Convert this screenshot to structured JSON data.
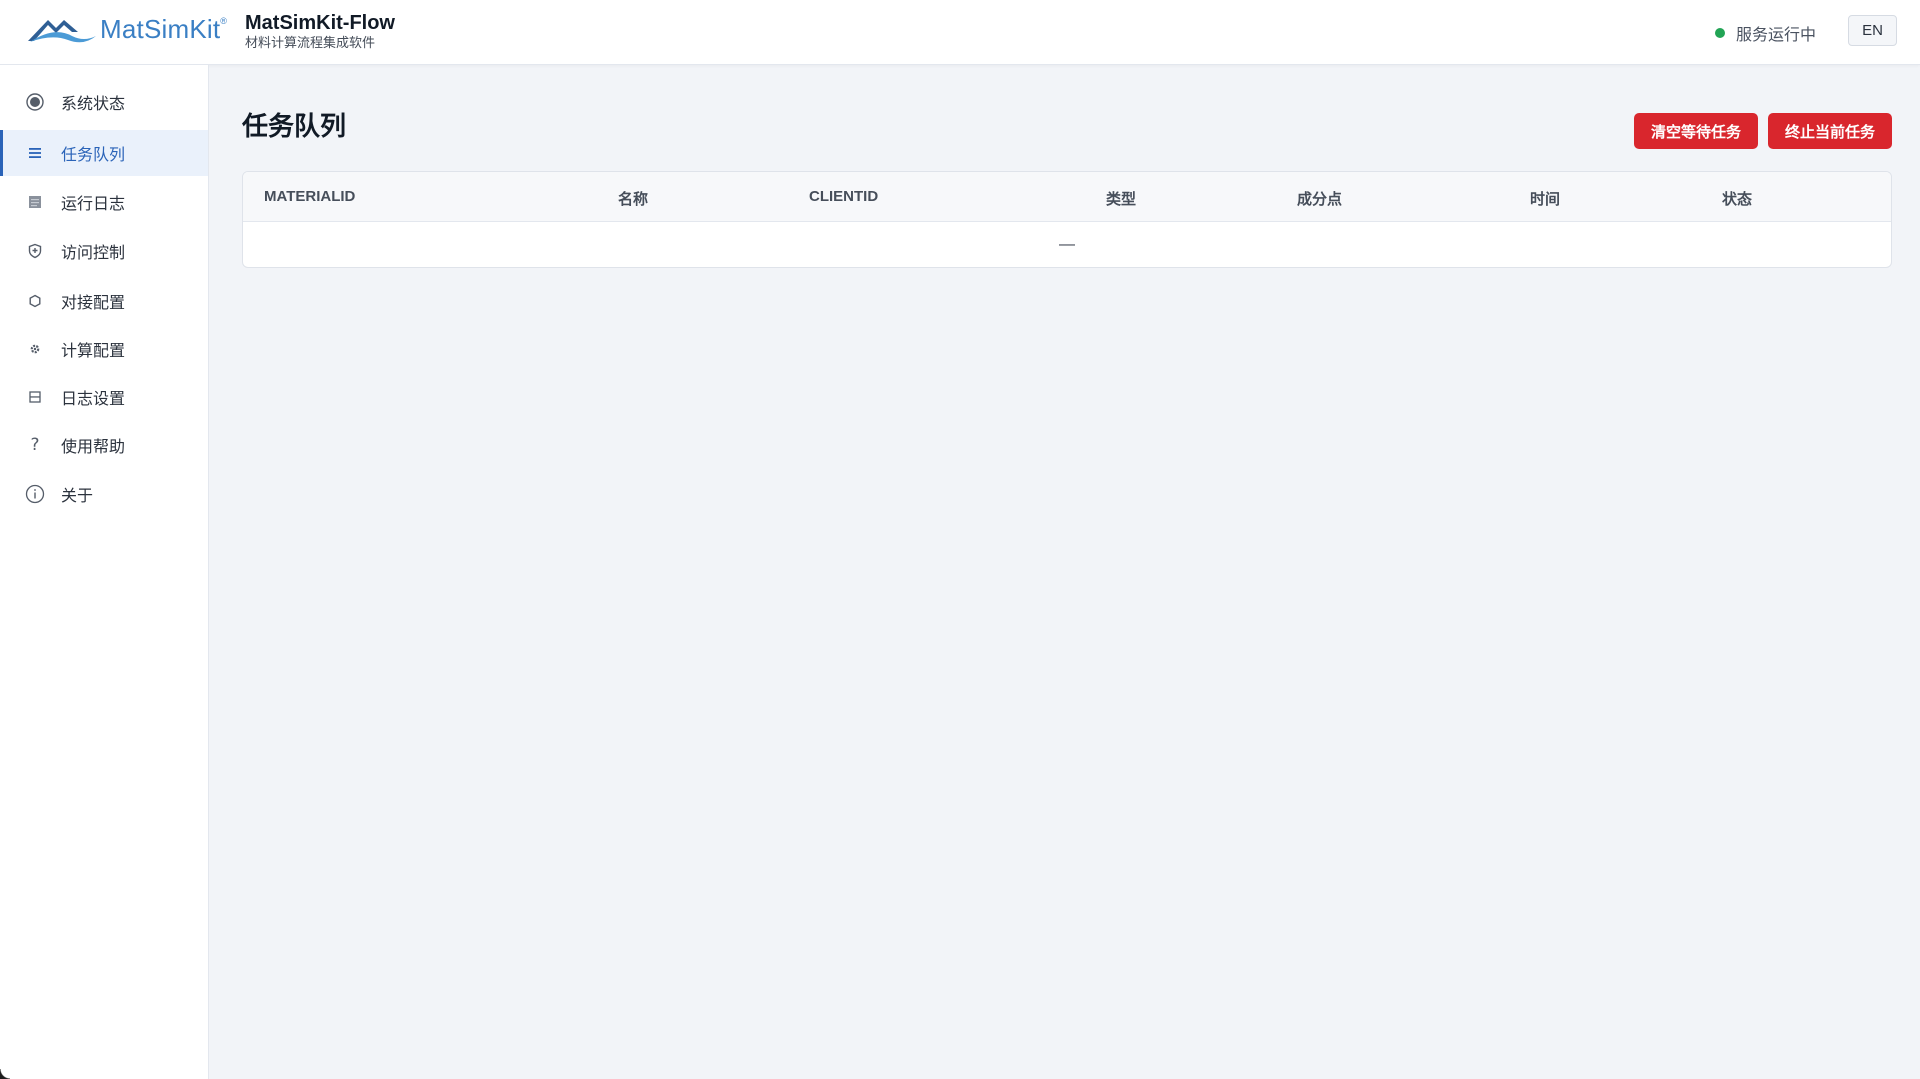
{
  "brand": {
    "logo_text": "MatSimKit",
    "logo_mark": "®",
    "product_name": "MatSimKit-Flow",
    "product_subtitle": "材料计算流程集成软件"
  },
  "header": {
    "status_text": "服务运行中",
    "status_color": "#22a455",
    "lang_label": "EN"
  },
  "sidebar": {
    "items": [
      {
        "label": "系统状态",
        "icon": "radio-dot-icon"
      },
      {
        "label": "任务队列",
        "icon": "list-icon",
        "active": true
      },
      {
        "label": "运行日志",
        "icon": "document-icon"
      },
      {
        "label": "访问控制",
        "icon": "shield-icon"
      },
      {
        "label": "对接配置",
        "icon": "hexagon-icon"
      },
      {
        "label": "计算配置",
        "icon": "gear-icon"
      },
      {
        "label": "日志设置",
        "icon": "sliders-icon"
      },
      {
        "label": "使用帮助",
        "icon": "question-icon"
      },
      {
        "label": "关于",
        "icon": "info-icon"
      }
    ]
  },
  "main": {
    "title": "任务队列",
    "clear_button": "清空等待任务",
    "stop_button": "终止当前任务",
    "danger_color": "#d9262d",
    "table": {
      "columns": [
        "MATERIALID",
        "名称",
        "CLIENTID",
        "类型",
        "成分点",
        "时间",
        "状态"
      ],
      "empty_text": "—"
    }
  }
}
